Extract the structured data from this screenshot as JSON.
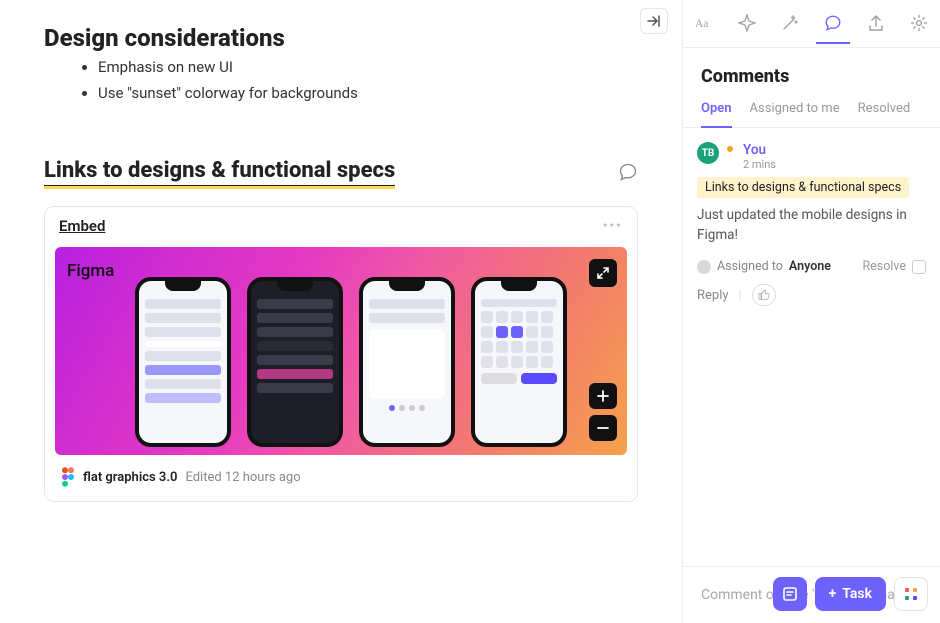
{
  "main": {
    "heading1": "Design considerations",
    "bullets": [
      "Emphasis on new UI",
      "Use \"sunset\" colorway for backgrounds"
    ],
    "heading2": "Links to designs & functional specs",
    "embed": {
      "title": "Embed",
      "tool_label": "Figma",
      "file_name": "flat graphics 3.0",
      "edited": "Edited 12 hours ago"
    }
  },
  "sidebar": {
    "title": "Comments",
    "tabs": {
      "open": "Open",
      "assigned": "Assigned to me",
      "resolved": "Resolved"
    },
    "thread": {
      "avatar_initials": "TB",
      "author": "You",
      "when": "2 mins",
      "reference": "Links to designs & functional specs",
      "message": "Just updated the mobile designs in Figma!",
      "assigned_label": "Assigned to",
      "assigned_to": "Anyone",
      "resolve_label": "Resolve",
      "reply_label": "Reply"
    },
    "composer_placeholder": "Comment or type '/' for commands"
  },
  "bottom": {
    "task_label": "Task"
  }
}
